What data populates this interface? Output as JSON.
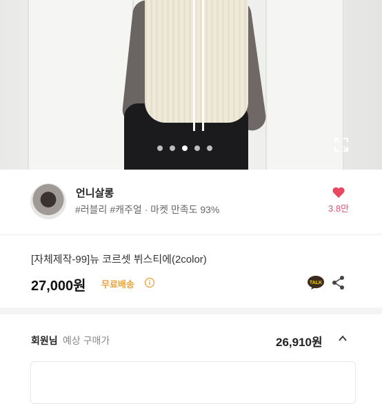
{
  "carousel": {
    "dot_count": 5,
    "active_index": 2
  },
  "seller": {
    "name": "언니살롱",
    "meta": "#러블리 #캐주얼 · 마켓 만족도 93%",
    "likes": "3.8만"
  },
  "product": {
    "title": "[자체제작-99]뉴 코르셋 뷔스티에(2color)",
    "price": "27,000원",
    "shipping": "무료배송"
  },
  "member_price": {
    "label": "회원님",
    "sub": "예상 구매가",
    "price": "26,910원"
  },
  "colors": {
    "heart": "#e8475f",
    "shipping": "#e8a33c",
    "talk_badge": "#3a2b1e"
  }
}
